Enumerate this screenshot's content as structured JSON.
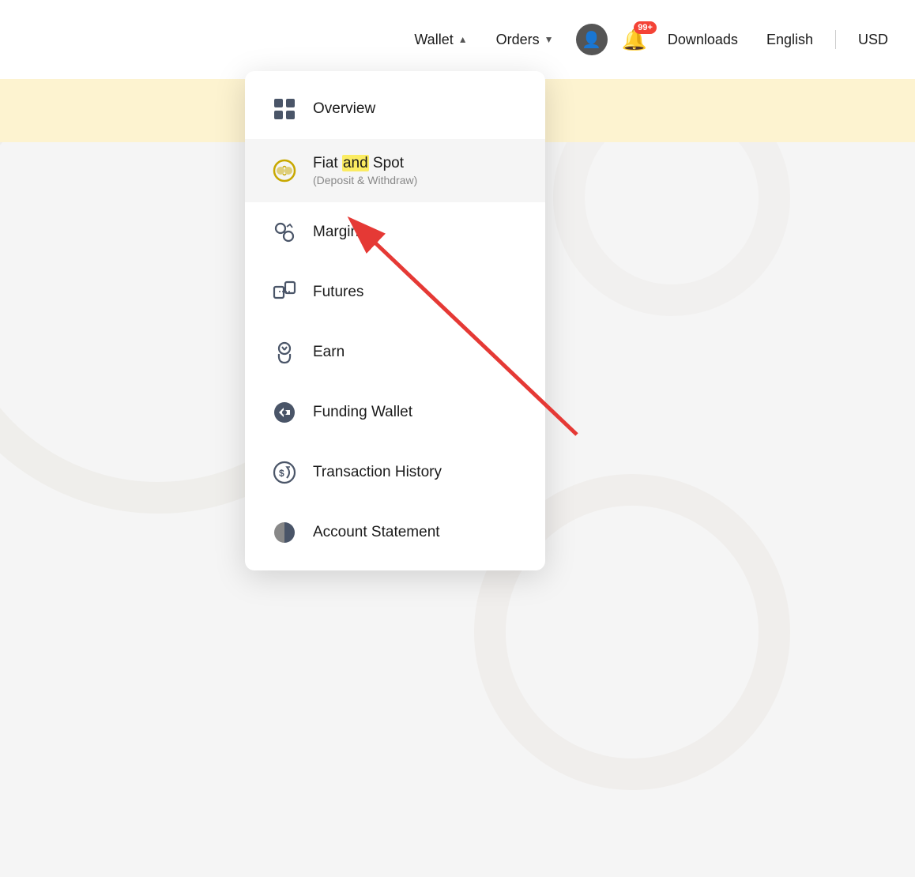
{
  "navbar": {
    "wallet_label": "Wallet",
    "orders_label": "Orders",
    "downloads_label": "Downloads",
    "english_label": "English",
    "currency_label": "USD",
    "notification_badge": "99+"
  },
  "menu": {
    "items": [
      {
        "id": "overview",
        "label": "Overview",
        "sublabel": "",
        "icon": "grid-icon"
      },
      {
        "id": "fiat-and-spot",
        "label": "Fiat and Spot",
        "sublabel": "(Deposit & Withdraw)",
        "icon": "fiat-icon"
      },
      {
        "id": "margin",
        "label": "Margin",
        "sublabel": "",
        "icon": "margin-icon"
      },
      {
        "id": "futures",
        "label": "Futures",
        "sublabel": "",
        "icon": "futures-icon"
      },
      {
        "id": "earn",
        "label": "Earn",
        "sublabel": "",
        "icon": "earn-icon"
      },
      {
        "id": "funding-wallet",
        "label": "Funding Wallet",
        "sublabel": "",
        "icon": "funding-icon"
      },
      {
        "id": "transaction-history",
        "label": "Transaction History",
        "sublabel": "",
        "icon": "transaction-icon"
      },
      {
        "id": "account-statement",
        "label": "Account Statement",
        "sublabel": "",
        "icon": "statement-icon"
      }
    ]
  }
}
